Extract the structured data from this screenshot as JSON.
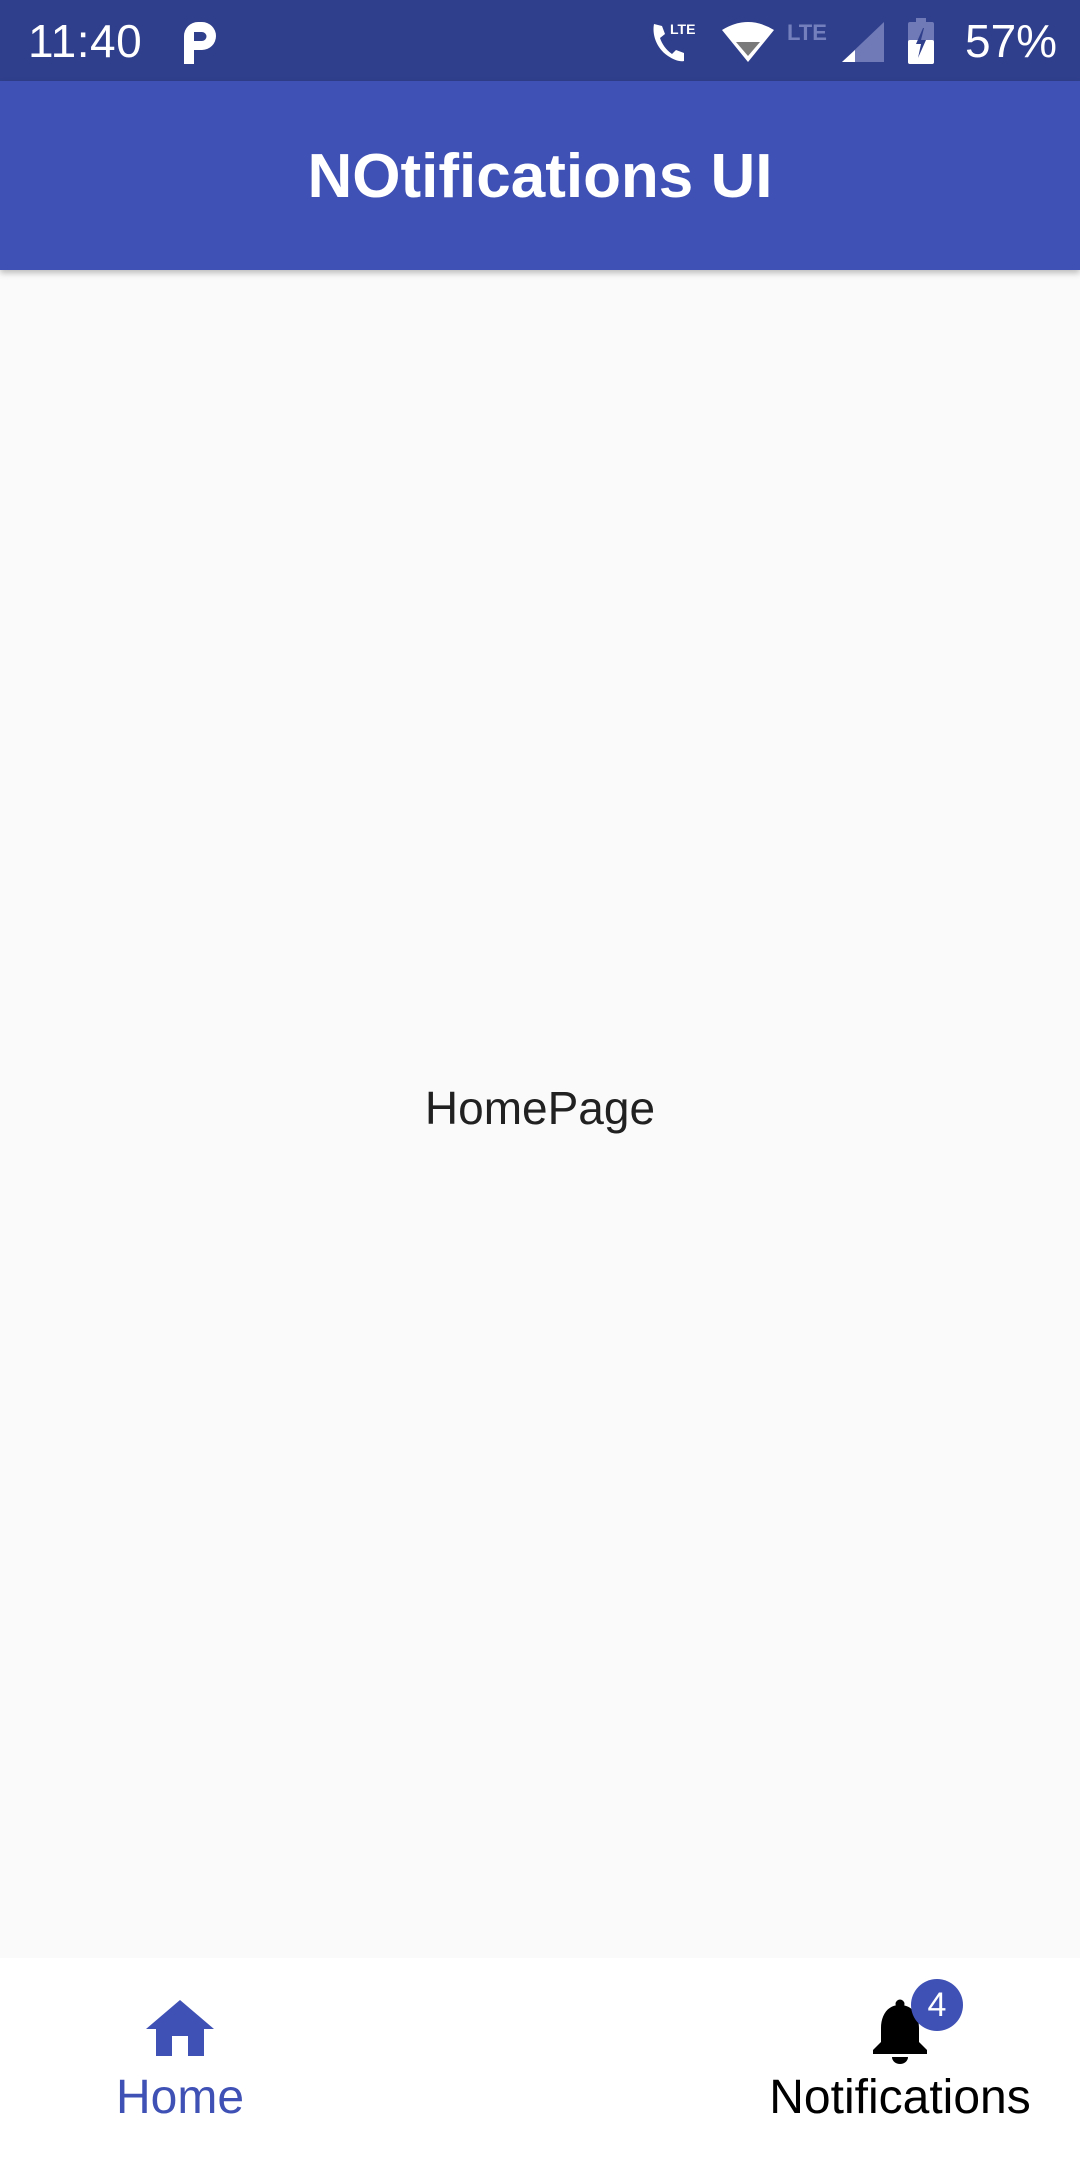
{
  "status_bar": {
    "time": "11:40",
    "notification_icons": [
      "parking-app-icon"
    ],
    "system_icons": [
      "volte-call-icon",
      "wifi-icon",
      "lte-icon",
      "cell-signal-icon",
      "battery-charging-icon"
    ],
    "call_network_label": "LTE",
    "data_network_label": "LTE",
    "battery_percent": "57%",
    "battery_level": 0.57
  },
  "app_bar": {
    "title": "NOtifications UI",
    "color": "#3f51b5"
  },
  "content": {
    "text": "HomePage"
  },
  "bottom_nav": {
    "items": [
      {
        "label": "Home",
        "icon": "home-icon",
        "selected": true
      },
      {
        "label": "Notifications",
        "icon": "bell-icon",
        "selected": false,
        "badge": "4"
      }
    ],
    "active_color": "#3f51b5",
    "inactive_color": "#000000"
  }
}
